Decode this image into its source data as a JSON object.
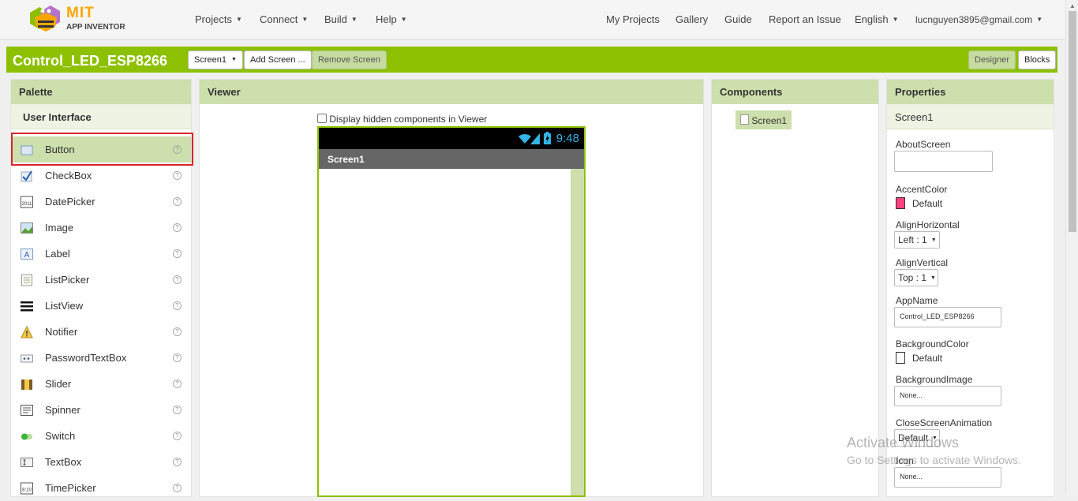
{
  "logo": {
    "mit": "MIT",
    "app_inventor": "APP INVENTOR"
  },
  "nav": {
    "left": [
      "Projects",
      "Connect",
      "Build",
      "Help"
    ],
    "my_projects": "My Projects",
    "gallery": "Gallery",
    "guide": "Guide",
    "report": "Report an Issue",
    "language": "English",
    "account": "lucnguyen3895@gmail.com"
  },
  "project": {
    "name": "Control_LED_ESP8266",
    "screen_select": "Screen1",
    "add_screen": "Add Screen ...",
    "remove_screen": "Remove Screen",
    "designer": "Designer",
    "blocks": "Blocks"
  },
  "palette": {
    "title": "Palette",
    "section": "User Interface",
    "items": [
      {
        "label": "Button",
        "icon": "button-icon"
      },
      {
        "label": "CheckBox",
        "icon": "checkbox-icon"
      },
      {
        "label": "DatePicker",
        "icon": "datepicker-icon"
      },
      {
        "label": "Image",
        "icon": "image-icon"
      },
      {
        "label": "Label",
        "icon": "label-icon"
      },
      {
        "label": "ListPicker",
        "icon": "listpicker-icon"
      },
      {
        "label": "ListView",
        "icon": "listview-icon"
      },
      {
        "label": "Notifier",
        "icon": "notifier-icon"
      },
      {
        "label": "PasswordTextBox",
        "icon": "password-icon"
      },
      {
        "label": "Slider",
        "icon": "slider-icon"
      },
      {
        "label": "Spinner",
        "icon": "spinner-icon"
      },
      {
        "label": "Switch",
        "icon": "switch-icon"
      },
      {
        "label": "TextBox",
        "icon": "textbox-icon"
      },
      {
        "label": "TimePicker",
        "icon": "timepicker-icon"
      }
    ],
    "help": "?",
    "datepicker_glyph": "2011",
    "timepicker_glyph": "8:10",
    "label_glyph": "A"
  },
  "viewer": {
    "title": "Viewer",
    "hidden_checkbox": "Display hidden components in Viewer",
    "time": "9:48",
    "screen_title": "Screen1"
  },
  "components": {
    "title": "Components",
    "root": "Screen1"
  },
  "properties": {
    "title": "Properties",
    "component": "Screen1",
    "about": "AboutScreen",
    "accent_label": "AccentColor",
    "accent_value": "Default",
    "accent_color": "#ff4081",
    "align_h_label": "AlignHorizontal",
    "align_h_value": "Left : 1",
    "align_v_label": "AlignVertical",
    "align_v_value": "Top : 1",
    "appname_label": "AppName",
    "appname_value": "Control_LED_ESP8266",
    "bgcolor_label": "BackgroundColor",
    "bgcolor_value": "Default",
    "bgimage_label": "BackgroundImage",
    "bgimage_value": "None...",
    "close_anim_label": "CloseScreenAnimation",
    "close_anim_value": "Default",
    "icon_label": "Icon",
    "icon_value": "None..."
  },
  "watermark": {
    "line1": "Activate Windows",
    "line2": "Go to Settings to activate Windows."
  },
  "colors": {
    "accent_green": "#8dc000",
    "panel_header": "#cddfac",
    "highlight_red": "#d9252b"
  }
}
